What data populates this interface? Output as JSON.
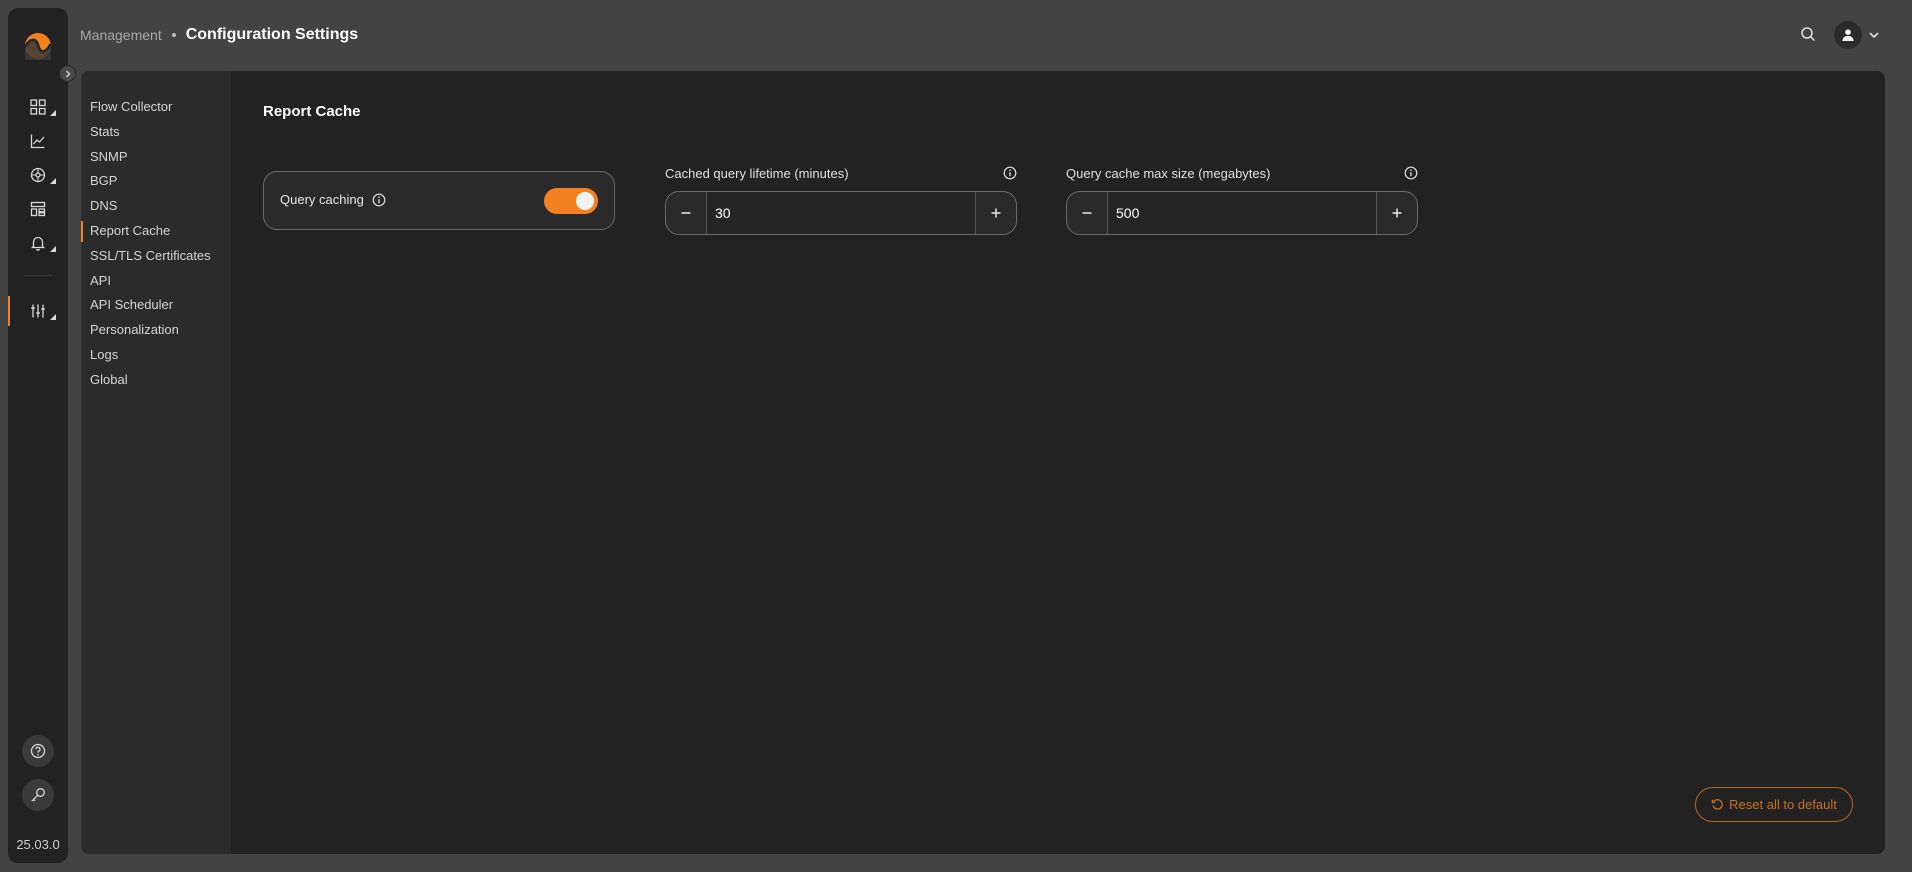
{
  "header": {
    "breadcrumb_parent": "Management",
    "breadcrumb_current": "Configuration Settings"
  },
  "rail": {
    "version": "25.03.0",
    "icons": [
      "dashboard-icon",
      "chart-icon",
      "explore-icon",
      "topology-icon",
      "bell-icon",
      "sliders-icon",
      "help-icon",
      "key-icon"
    ]
  },
  "subnav": {
    "items": [
      {
        "label": "Flow Collector"
      },
      {
        "label": "Stats"
      },
      {
        "label": "SNMP"
      },
      {
        "label": "BGP"
      },
      {
        "label": "DNS"
      },
      {
        "label": "Report Cache"
      },
      {
        "label": "SSL/TLS Certificates"
      },
      {
        "label": "API"
      },
      {
        "label": "API Scheduler"
      },
      {
        "label": "Personalization"
      },
      {
        "label": "Logs"
      },
      {
        "label": "Global"
      }
    ],
    "active": "Report Cache"
  },
  "section": {
    "title": "Report Cache",
    "query_caching": {
      "label": "Query caching",
      "enabled": true
    },
    "lifetime": {
      "label": "Cached query lifetime (minutes)",
      "value": "30"
    },
    "max_size": {
      "label": "Query cache max size (megabytes)",
      "value": "500"
    }
  },
  "actions": {
    "reset_label": "Reset all to default"
  },
  "colors": {
    "accent": "#f48120",
    "background": "#434343",
    "panel": "#222222"
  }
}
